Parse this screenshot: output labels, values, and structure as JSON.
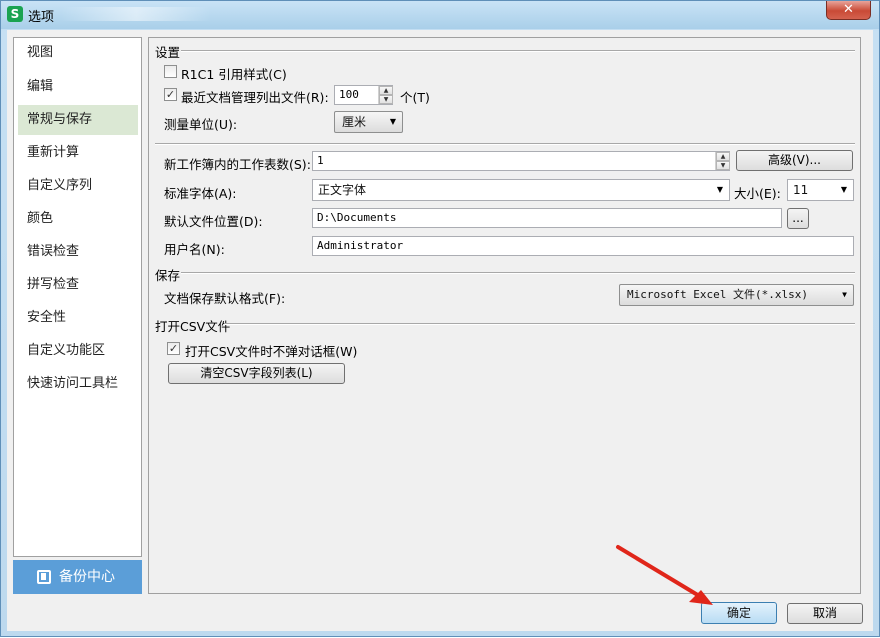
{
  "window": {
    "title": "选项",
    "app_icon": "S",
    "close_glyph": "✕"
  },
  "nav": {
    "items": [
      "视图",
      "编辑",
      "常规与保存",
      "重新计算",
      "自定义序列",
      "颜色",
      "错误检查",
      "拼写检查",
      "安全性",
      "自定义功能区",
      "快速访问工具栏"
    ],
    "selected_index": 2,
    "backup_label": "备份中心"
  },
  "settings": {
    "section_title": "设置",
    "r1c1_label": "R1C1 引用样式(C)",
    "r1c1_checked": false,
    "recent_files_label": "最近文档管理列出文件(R):",
    "recent_files_checked": true,
    "recent_files_value": "100",
    "recent_files_unit": "个(T)",
    "measure_unit_label": "测量单位(U):",
    "measure_unit_value": "厘米",
    "sheets_label": "新工作簿内的工作表数(S):",
    "sheets_value": "1",
    "advanced_button": "高级(V)...",
    "font_label": "标准字体(A):",
    "font_value": "正文字体",
    "size_label": "大小(E):",
    "size_value": "11",
    "file_location_label": "默认文件位置(D):",
    "file_location_value": "D:\\Documents",
    "browse_button": "...",
    "username_label": "用户名(N):",
    "username_value": "Administrator"
  },
  "save": {
    "section_title": "保存",
    "format_label": "文档保存默认格式(F):",
    "format_value": "Microsoft Excel 文件(*.xlsx)"
  },
  "csv": {
    "section_title": "打开CSV文件",
    "no_dialog_label": "打开CSV文件时不弹对话框(W)",
    "no_dialog_checked": true,
    "clear_button": "清空CSV字段列表(L)"
  },
  "footer": {
    "ok_button": "确定",
    "cancel_button": "取消"
  },
  "colors": {
    "accent": "#5b9ed8",
    "selected_nav": "#dbe8d4",
    "annotation_arrow": "#e0261a"
  }
}
